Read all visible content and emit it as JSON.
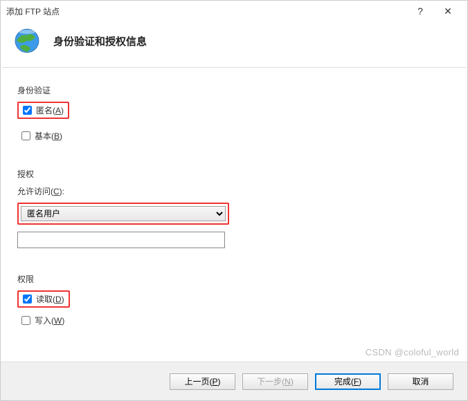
{
  "titlebar": {
    "title": "添加 FTP 站点",
    "help": "?",
    "close": "✕"
  },
  "header": {
    "title": "身份验证和授权信息"
  },
  "auth": {
    "group_label": "身份验证",
    "anonymous": {
      "label_pre": "匿名(",
      "label_u": "A",
      "label_post": ")",
      "checked": true
    },
    "basic": {
      "label_pre": "基本(",
      "label_u": "B",
      "label_post": ")",
      "checked": false
    }
  },
  "authz": {
    "group_label": "授权",
    "allow_label_pre": "允许访问(",
    "allow_label_u": "C",
    "allow_label_post": "):",
    "selected": "匿名用户",
    "textbox": ""
  },
  "perm": {
    "group_label": "权限",
    "read": {
      "label_pre": "读取(",
      "label_u": "D",
      "label_post": ")",
      "checked": true
    },
    "write": {
      "label_pre": "写入(",
      "label_u": "W",
      "label_post": ")",
      "checked": false
    }
  },
  "footer": {
    "prev_pre": "上一页(",
    "prev_u": "P",
    "prev_post": ")",
    "next_pre": "下一步(",
    "next_u": "N",
    "next_post": ")",
    "finish_pre": "完成(",
    "finish_u": "F",
    "finish_post": ")",
    "cancel": "取消"
  },
  "watermark": "CSDN @coloful_world"
}
